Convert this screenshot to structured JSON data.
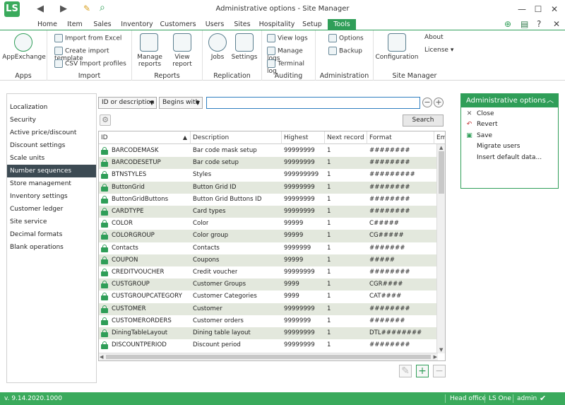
{
  "window": {
    "title": "Administrative options - Site Manager",
    "logo": "LS"
  },
  "tabs": [
    "Home",
    "Item",
    "Sales",
    "Inventory",
    "Customers",
    "Users",
    "Sites",
    "Hospitality",
    "Setup",
    "Tools"
  ],
  "active_tab": "Tools",
  "ribbon": {
    "apps": {
      "label": "Apps",
      "appexchange": "AppExchange"
    },
    "import": {
      "label": "Import",
      "excel": "Import from Excel",
      "template": "Create import template",
      "csv": "CSV Import profiles"
    },
    "reports": {
      "label": "Reports",
      "manage": "Manage reports",
      "view": "View report"
    },
    "replication": {
      "label": "Replication",
      "jobs": "Jobs",
      "settings": "Settings"
    },
    "auditing": {
      "label": "Auditing",
      "view": "View logs",
      "manage": "Manage logs",
      "terminal": "Terminal log"
    },
    "administration": {
      "label": "Administration",
      "options": "Options",
      "backup": "Backup"
    },
    "site_manager": {
      "label": "Site Manager",
      "configuration": "Configuration",
      "about": "About",
      "license": "License"
    }
  },
  "nav": {
    "items": [
      "Localization",
      "Security",
      "Active price/discount",
      "Discount settings",
      "Scale units",
      "Number sequences",
      "Store management",
      "Inventory settings",
      "Customer ledger",
      "Site service",
      "Decimal formats",
      "Blank operations"
    ],
    "active": "Number sequences"
  },
  "filter": {
    "field": "ID or description",
    "mode": "Begins with",
    "value": "",
    "search_label": "Search"
  },
  "grid": {
    "columns": [
      "ID",
      "Description",
      "Highest",
      "Next record",
      "Format",
      "Emb"
    ],
    "rows": [
      {
        "id": "BARCODEMASK",
        "desc": "Bar code mask setup",
        "highest": "99999999",
        "next": "1",
        "format": "########"
      },
      {
        "id": "BARCODESETUP",
        "desc": "Bar code setup",
        "highest": "99999999",
        "next": "1",
        "format": "########"
      },
      {
        "id": "BTNSTYLES",
        "desc": "Styles",
        "highest": "999999999",
        "next": "1",
        "format": "#########"
      },
      {
        "id": "ButtonGrid",
        "desc": "Button Grid ID",
        "highest": "99999999",
        "next": "1",
        "format": "########"
      },
      {
        "id": "ButtonGridButtons",
        "desc": "Button Grid Buttons ID",
        "highest": "99999999",
        "next": "1",
        "format": "########"
      },
      {
        "id": "CARDTYPE",
        "desc": "Card types",
        "highest": "99999999",
        "next": "1",
        "format": "########"
      },
      {
        "id": "COLOR",
        "desc": "Color",
        "highest": "99999",
        "next": "1",
        "format": "C#####"
      },
      {
        "id": "COLORGROUP",
        "desc": "Color group",
        "highest": "99999",
        "next": "1",
        "format": "CG#####"
      },
      {
        "id": "Contacts",
        "desc": "Contacts",
        "highest": "9999999",
        "next": "1",
        "format": "#######"
      },
      {
        "id": "COUPON",
        "desc": "Coupons",
        "highest": "99999",
        "next": "1",
        "format": "#####"
      },
      {
        "id": "CREDITVOUCHER",
        "desc": "Credit voucher",
        "highest": "99999999",
        "next": "1",
        "format": "########"
      },
      {
        "id": "CUSTGROUP",
        "desc": "Customer Groups",
        "highest": "9999",
        "next": "1",
        "format": "CGR####"
      },
      {
        "id": "CUSTGROUPCATEGORY",
        "desc": "Customer Categories",
        "highest": "9999",
        "next": "1",
        "format": "CAT####"
      },
      {
        "id": "CUSTOMER",
        "desc": "Customer",
        "highest": "99999999",
        "next": "1",
        "format": "########"
      },
      {
        "id": "CUSTOMERORDERS",
        "desc": "Customer orders",
        "highest": "9999999",
        "next": "1",
        "format": "#######"
      },
      {
        "id": "DiningTableLayout",
        "desc": "Dining table layout",
        "highest": "99999999",
        "next": "1",
        "format": "DTL########"
      },
      {
        "id": "DISCOUNTPERIOD",
        "desc": "Discount period",
        "highest": "99999999",
        "next": "1",
        "format": "########"
      }
    ]
  },
  "admin_panel": {
    "title": "Administrative options",
    "actions": [
      "Close",
      "Revert",
      "Save",
      "Migrate users",
      "Insert default data..."
    ]
  },
  "status": {
    "version": "v. 9.14.2020.1000",
    "site": "Head office",
    "product": "LS One",
    "user": "admin"
  },
  "colors": {
    "accent": "#2f9e58",
    "nav_active": "#3c4a53",
    "row_alt": "#e3e8dd"
  }
}
